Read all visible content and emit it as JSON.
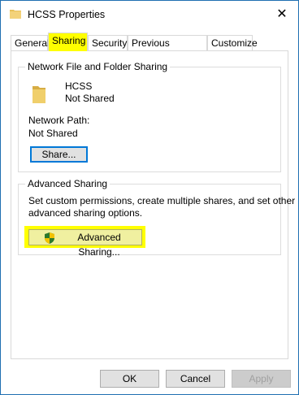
{
  "window": {
    "title": "HCSS Properties",
    "close_glyph": "✕"
  },
  "tabs": [
    {
      "label": "General"
    },
    {
      "label": "Sharing"
    },
    {
      "label": "Security"
    },
    {
      "label": "Previous Versions"
    },
    {
      "label": "Customize"
    }
  ],
  "network_sharing": {
    "group_title": "Network File and Folder Sharing",
    "folder_name": "HCSS",
    "folder_status": "Not Shared",
    "network_path_label": "Network Path:",
    "network_path_value": "Not Shared",
    "share_button": "Share..."
  },
  "advanced_sharing": {
    "group_title": "Advanced Sharing",
    "description_line1": "Set custom permissions, create multiple shares, and set other",
    "description_line2": "advanced sharing options.",
    "button_label": "Advanced Sharing..."
  },
  "footer": {
    "ok": "OK",
    "cancel": "Cancel",
    "apply": "Apply"
  },
  "colors": {
    "highlight": "#ffff00",
    "border_blue": "#1f6fb2",
    "folder": "#e8c15a"
  },
  "icons": {
    "title": "folder-icon",
    "close": "close-icon",
    "folder": "folder-icon",
    "shield": "uac-shield-icon"
  }
}
